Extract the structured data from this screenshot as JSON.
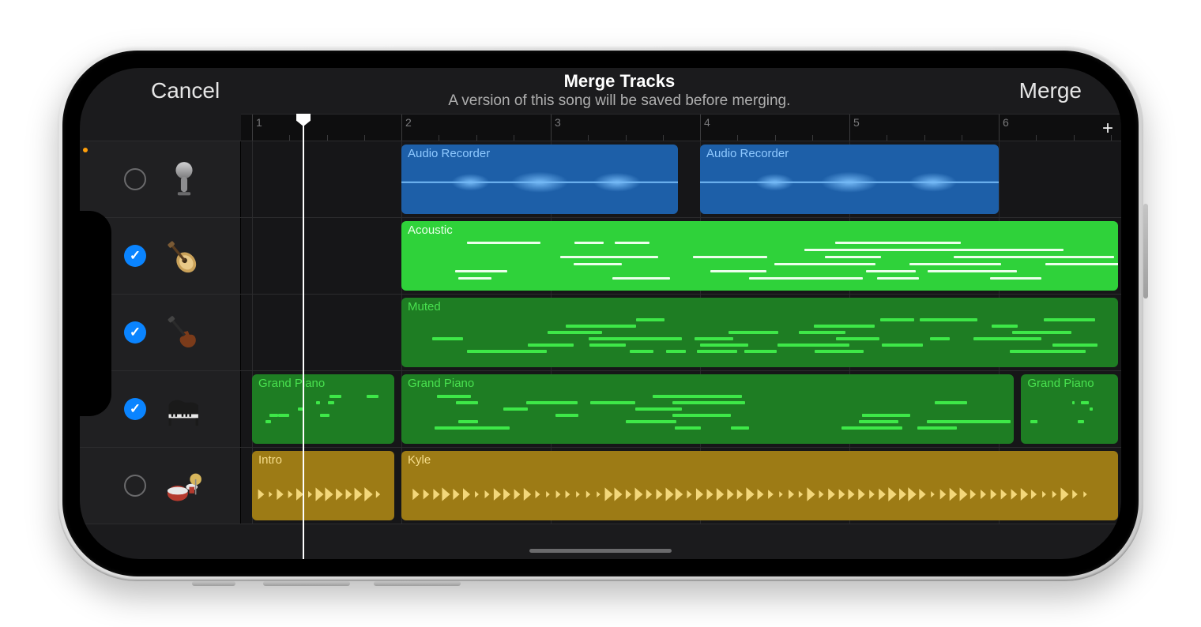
{
  "header": {
    "cancel": "Cancel",
    "title": "Merge Tracks",
    "subtitle": "A version of this song will be saved before merging.",
    "merge": "Merge"
  },
  "timeline": {
    "bars": [
      "1",
      "2",
      "3",
      "4",
      "5",
      "6"
    ],
    "addButton": "+"
  },
  "tracks": [
    {
      "id": "mic",
      "icon": "mic",
      "selected": false,
      "hasDot": true,
      "regions": [
        {
          "label": "Audio Recorder",
          "color": "blue",
          "startBar": 2,
          "endBar": 3.85
        },
        {
          "label": "Audio Recorder",
          "color": "blue",
          "startBar": 4,
          "endBar": 6.0
        }
      ]
    },
    {
      "id": "acoustic-guitar",
      "icon": "acoustic-guitar",
      "selected": true,
      "regions": [
        {
          "label": "Acoustic",
          "color": "green-bright",
          "startBar": 2,
          "endBar": 6.8
        }
      ]
    },
    {
      "id": "electric-guitar",
      "icon": "electric-guitar",
      "selected": true,
      "regions": [
        {
          "label": "Muted",
          "color": "green-dark",
          "startBar": 2,
          "endBar": 6.8
        }
      ]
    },
    {
      "id": "piano",
      "icon": "piano",
      "selected": true,
      "regions": [
        {
          "label": "Grand Piano",
          "color": "green-dark",
          "startBar": 1,
          "endBar": 1.95
        },
        {
          "label": "Grand Piano",
          "color": "green-dark",
          "startBar": 2,
          "endBar": 6.1
        },
        {
          "label": "Grand Piano",
          "color": "green-dark",
          "startBar": 6.15,
          "endBar": 6.8
        }
      ]
    },
    {
      "id": "drums",
      "icon": "drums",
      "selected": false,
      "regions": [
        {
          "label": "Intro",
          "color": "gold",
          "startBar": 1,
          "endBar": 1.95
        },
        {
          "label": "Kyle",
          "color": "gold",
          "startBar": 2,
          "endBar": 6.8
        }
      ]
    }
  ],
  "layout": {
    "barWidth": 189,
    "bar1Offset": 14
  }
}
